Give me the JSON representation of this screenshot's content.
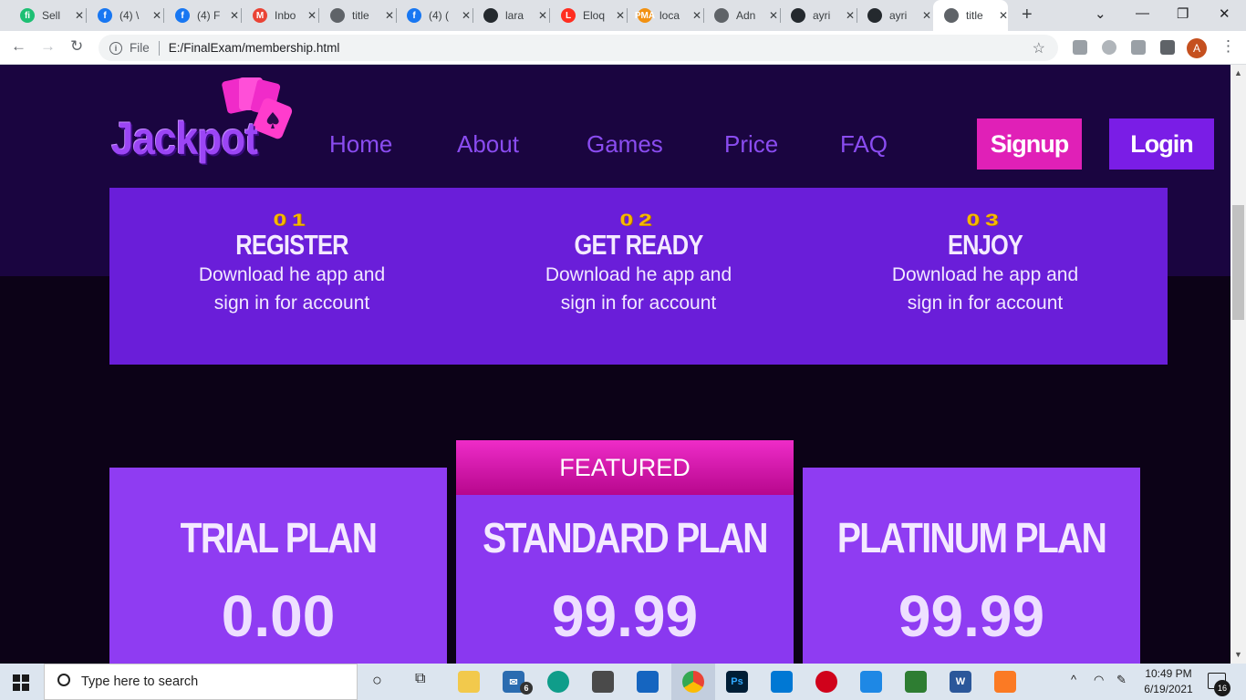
{
  "browser": {
    "tabs": [
      {
        "label": "Sell",
        "icon": "fiverr-icon",
        "color": "#1dbf73",
        "glyph": "fi"
      },
      {
        "label": "(4) \\",
        "icon": "facebook-icon",
        "color": "#1877f2",
        "glyph": "f"
      },
      {
        "label": "(4) F",
        "icon": "facebook-icon",
        "color": "#1877f2",
        "glyph": "f"
      },
      {
        "label": "Inbo",
        "icon": "gmail-icon",
        "color": "#ea4335",
        "glyph": "M"
      },
      {
        "label": "title",
        "icon": "globe-icon",
        "color": "#5f6368",
        "glyph": ""
      },
      {
        "label": "(4) (",
        "icon": "facebook-icon",
        "color": "#1877f2",
        "glyph": "f"
      },
      {
        "label": "lara",
        "icon": "github-icon",
        "color": "#24292e",
        "glyph": ""
      },
      {
        "label": "Eloq",
        "icon": "laravel-icon",
        "color": "#ff2d20",
        "glyph": "L"
      },
      {
        "label": "loca",
        "icon": "phpmyadmin-icon",
        "color": "#f29111",
        "glyph": "PMA"
      },
      {
        "label": "Adn",
        "icon": "globe-icon",
        "color": "#5f6368",
        "glyph": ""
      },
      {
        "label": "ayri",
        "icon": "github-icon",
        "color": "#24292e",
        "glyph": ""
      },
      {
        "label": "ayri",
        "icon": "github-icon",
        "color": "#24292e",
        "glyph": ""
      },
      {
        "label": "title",
        "icon": "globe-icon",
        "color": "#5f6368",
        "glyph": "",
        "active": true
      }
    ],
    "close_glyph": "✕",
    "new_tab_glyph": "+",
    "file_label": "File",
    "url": "E:/FinalExam/membership.html",
    "profile_initial": "A"
  },
  "site": {
    "logo_text": "Jackpot",
    "nav": [
      "Home",
      "About",
      "Games",
      "Price",
      "FAQ"
    ],
    "signup_label": "Signup",
    "login_label": "Login",
    "steps": [
      {
        "num": "01",
        "title": "REGISTER",
        "desc": "Download he app and sign in for account"
      },
      {
        "num": "02",
        "title": "GET READY",
        "desc": "Download he app and sign in for account"
      },
      {
        "num": "03",
        "title": "ENJOY",
        "desc": "Download he app and sign in for account"
      }
    ],
    "featured_label": "FEATURED",
    "plans": [
      {
        "title": "TRIAL PLAN",
        "price": "0.00"
      },
      {
        "title": "STANDARD PLAN",
        "price": "99.99"
      },
      {
        "title": "PLATINUM PLAN",
        "price": "99.99"
      }
    ],
    "colors": {
      "accent_pink": "#e020b7",
      "accent_purple": "#7a1de6",
      "steps_bg": "#6a1ed9",
      "plan_bg": "#8f3cf2"
    }
  },
  "taskbar": {
    "search_placeholder": "Type here to search",
    "mail_badge": "6",
    "time": "10:49 PM",
    "date": "6/19/2021",
    "notification_count": "16"
  }
}
